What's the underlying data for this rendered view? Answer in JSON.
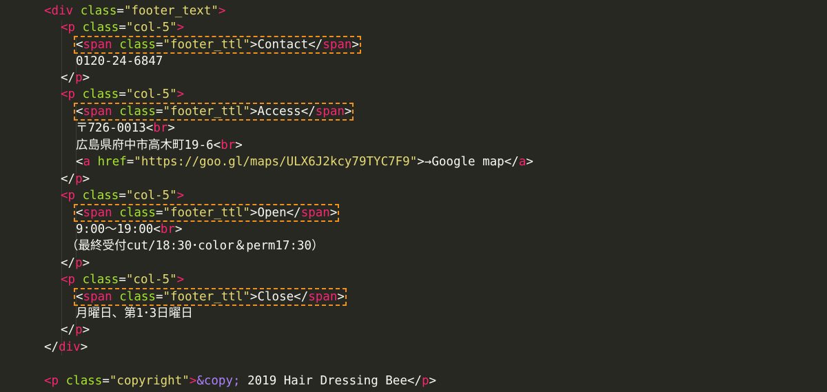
{
  "colors": {
    "background": "#272822",
    "tag": "#f92672",
    "attribute": "#a6e22e",
    "string": "#e6db74",
    "entity": "#ae81ff",
    "text": "#f8f8f2",
    "highlight_box": "#f2901e"
  },
  "code": {
    "div_open": {
      "lt": "<",
      "tag": "div",
      "attr": "class",
      "eq": "=",
      "value": "\"footer_text\"",
      "gt": ">"
    },
    "p_open": {
      "lt": "<",
      "tag": "p",
      "attr": "class",
      "eq": "=",
      "value": "\"col-5\"",
      "gt": ">"
    },
    "span_open": {
      "lt": "<",
      "tag": "span",
      "attr": "class",
      "eq": "=",
      "value": "\"footer_ttl\"",
      "gt": ">"
    },
    "span_close": {
      "lt": "</",
      "tag": "span",
      "gt": ">"
    },
    "p_close": {
      "lt": "</",
      "tag": "p",
      "gt": ">"
    },
    "div_close": {
      "lt": "</",
      "tag": "div",
      "gt": ">"
    },
    "br_tag": {
      "lt": "<",
      "tag": "br",
      "gt": ">"
    },
    "contact": {
      "title": "Contact",
      "phone": "0120-24-6847"
    },
    "access": {
      "title": "Access",
      "postal": "〒726-0013",
      "address": "広島県府中市高木町19-6",
      "link_tag": "a",
      "link_attr": "href",
      "link_href": "\"https://goo.gl/maps/ULX6J2kcy79TYC7F9\"",
      "link_text": "→Google map"
    },
    "open": {
      "title": "Open",
      "hours": "9:00〜19:00",
      "note": "（最終受付cut/18:30･color＆perm17:30）"
    },
    "close": {
      "title": "Close",
      "days": "月曜日、第1･3日曜日"
    },
    "copyright": {
      "tag": "p",
      "attr": "class",
      "value": "\"copyright\"",
      "entity": "&copy;",
      "text": " 2019 Hair Dressing Bee"
    }
  }
}
